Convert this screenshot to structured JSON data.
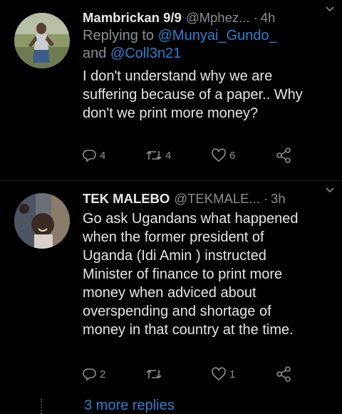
{
  "tweets": [
    {
      "name": "Mambrickan 9/9",
      "handle": "@Mphez...",
      "separator": "·",
      "time": "4h",
      "reply_prefix": "Replying to ",
      "reply_mention_1": "@Munyai_Gundo_",
      "reply_and": "and ",
      "reply_mention_2": "@Coll3n21",
      "text_lines": [
        "I don't understand why we are",
        "suffering because of a paper.. Why",
        "don't we print more money?"
      ],
      "reply_count": "4",
      "retweet_count": "4",
      "like_count": "6"
    },
    {
      "name": "TEK MALEBO",
      "handle": "@TEKMALE...",
      "separator": "·",
      "time": "3h",
      "text_lines": [
        "Go ask Ugandans what happened",
        "when the former president of",
        "Uganda (Idi Amin ) instructed",
        "Minister of finance to print more",
        "money when adviced about",
        "overspending and shortage of",
        "money in that country at the time."
      ],
      "reply_count": "2",
      "retweet_count": "",
      "like_count": "1"
    }
  ],
  "more_replies": "3 more replies",
  "colors": {
    "background": "#000000",
    "text": "#e6e6e6",
    "secondary": "#8a8f94",
    "link": "#2f7fd1"
  }
}
